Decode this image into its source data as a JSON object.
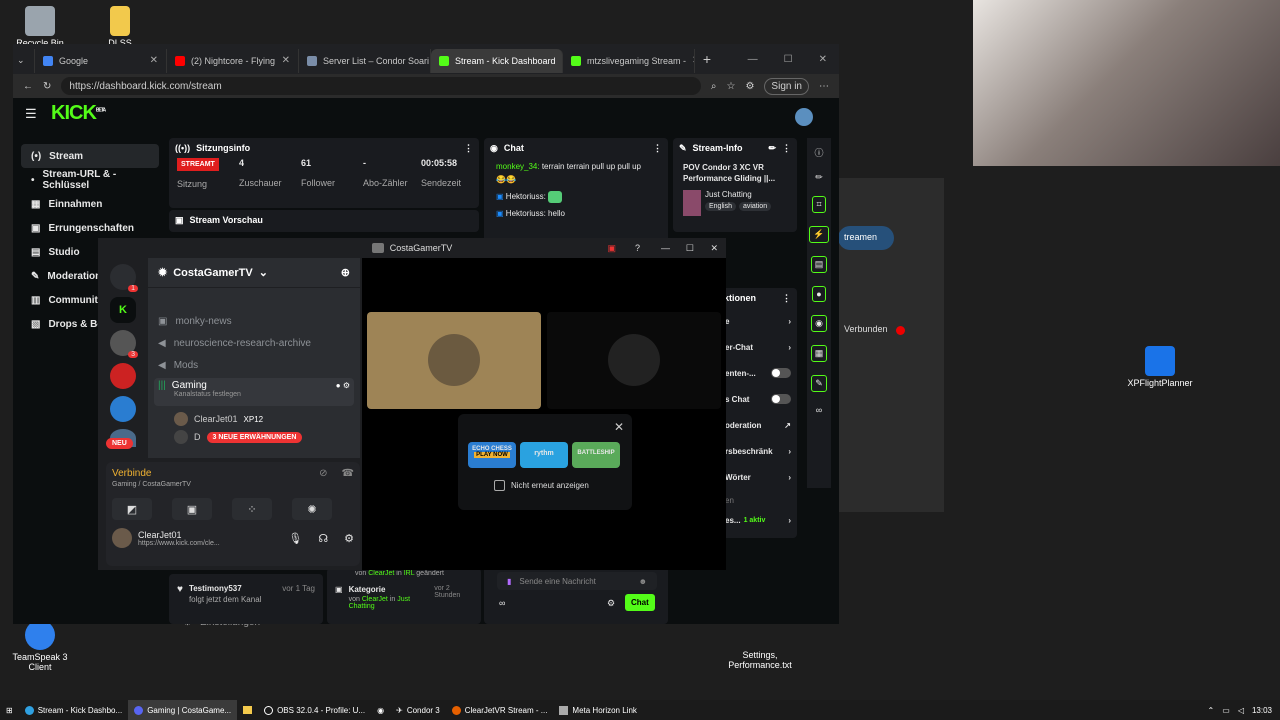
{
  "desktop": {
    "icons": [
      {
        "label": "Recycle Bin"
      },
      {
        "label": "DLSS"
      },
      {
        "label": "TeamSpeak 3 Client"
      },
      {
        "label": "XPFlightPlanner"
      },
      {
        "label": "Settings, Performance.txt"
      }
    ]
  },
  "browser": {
    "tabs": [
      {
        "label": "Google"
      },
      {
        "label": "(2) Nightcore - Flying"
      },
      {
        "label": "Server List – Condor Soari"
      },
      {
        "label": "Stream - Kick Dashboard"
      },
      {
        "label": "mtzslivegaming Stream - "
      }
    ],
    "url": "https://dashboard.kick.com/stream",
    "signin": "Sign in"
  },
  "kick": {
    "logo": "KICK",
    "logo_badge": "BETA",
    "sidebar": [
      {
        "label": "Stream"
      },
      {
        "label": "Stream-URL & -Schlüssel"
      },
      {
        "label": "Einnahmen"
      },
      {
        "label": "Errungenschaften"
      },
      {
        "label": "Studio"
      },
      {
        "label": "Moderation"
      },
      {
        "label": "Community"
      },
      {
        "label": "Drops & Bel"
      },
      {
        "label": "Einstellungen"
      }
    ],
    "session": {
      "title": "Sitzungsinfo",
      "status": "STREAMT",
      "status_label": "Sitzung",
      "viewers": "4",
      "viewers_label": "Zuschauer",
      "followers": "61",
      "followers_label": "Follower",
      "subs": "-",
      "subs_label": "Abo-Zähler",
      "time": "00:05:58",
      "time_label": "Sendezeit"
    },
    "preview": {
      "title": "Stream Vorschau"
    },
    "chat": {
      "title": "Chat",
      "messages": [
        {
          "user": "monkey_34:",
          "text": "terrain terrain pull up pull up"
        },
        {
          "user": "",
          "text": "😂😂"
        },
        {
          "user": "Hektoriuss:",
          "text": ""
        },
        {
          "user": "Hektoriuss:",
          "text": "hello"
        }
      ],
      "input_placeholder": "Sende eine Nachricht",
      "send": "Chat"
    },
    "stream_info": {
      "title": "Stream-Info",
      "stream_title": "POV Condor 3 XC VR Performance Gliding ||...",
      "category": "Just Chatting",
      "tags": [
        "English",
        "aviation"
      ]
    },
    "actions": {
      "title": "aktionen",
      "rows": [
        {
          "label": "e"
        },
        {
          "label": "er-Chat"
        },
        {
          "label": "enten-..."
        },
        {
          "label": "s Chat"
        },
        {
          "label": "oderation"
        },
        {
          "label": "rsbeschränk"
        },
        {
          "label": "Wörter"
        },
        {
          "label": "en"
        },
        {
          "label": "es...",
          "extra": "1 aktiv"
        }
      ]
    },
    "right_panel": {
      "stream_button": "treamen",
      "connected": "Verbunden"
    },
    "activity": [
      {
        "name": "Testimony537",
        "sub": "folgt jetzt dem Kanal",
        "time": "vor 1 Tag"
      },
      {
        "name": "Kategorie",
        "sub_prefix": "von",
        "user": "ClearJet",
        "sub_mid": "in",
        "value": "Just Chatting",
        "time": "vor 2 Stunden"
      },
      {
        "sub_prefix": "von",
        "user": "ClearJet",
        "sub_mid": "in",
        "value": "IRL",
        "suffix": "geändert"
      }
    ]
  },
  "discord": {
    "window_title": "CostaGamerTV",
    "server": "CostaGamerTV",
    "channels": [
      {
        "label": "monky-news"
      },
      {
        "label": "neuroscience-research-archive"
      },
      {
        "label": "Mods"
      },
      {
        "label": "Gaming",
        "sub": "Kanalstatus festlegen"
      }
    ],
    "voice_users": [
      {
        "name": "ClearJet01",
        "tag": "XP12"
      },
      {
        "name": "D"
      }
    ],
    "mentions_pill": "3 NEUE ERWÄHNUNGEN",
    "new_badge": "NEU",
    "guild_badges": [
      "1",
      "3"
    ],
    "connection": {
      "status": "Verbinde",
      "detail": "Gaming / CostaGamerTV"
    },
    "user": {
      "name": "ClearJet01",
      "status": "https://www.kick.com/cle..."
    },
    "activity_popup": {
      "checkbox": "Nicht erneut anzeigen",
      "cards": [
        "ECHO CHESS",
        "rythm",
        "BATTLESHIP"
      ],
      "card_sub": "PLAY NOW"
    }
  },
  "taskbar": {
    "items": [
      {
        "label": "Stream - Kick Dashbo..."
      },
      {
        "label": "Gaming | CostaGame..."
      },
      {
        "label": "OBS 32.0.4 - Profile: U..."
      },
      {
        "label": "Condor 3"
      },
      {
        "label": "ClearJetVR Stream - ..."
      },
      {
        "label": "Meta Horizon Link"
      }
    ],
    "clock": "13:03"
  }
}
